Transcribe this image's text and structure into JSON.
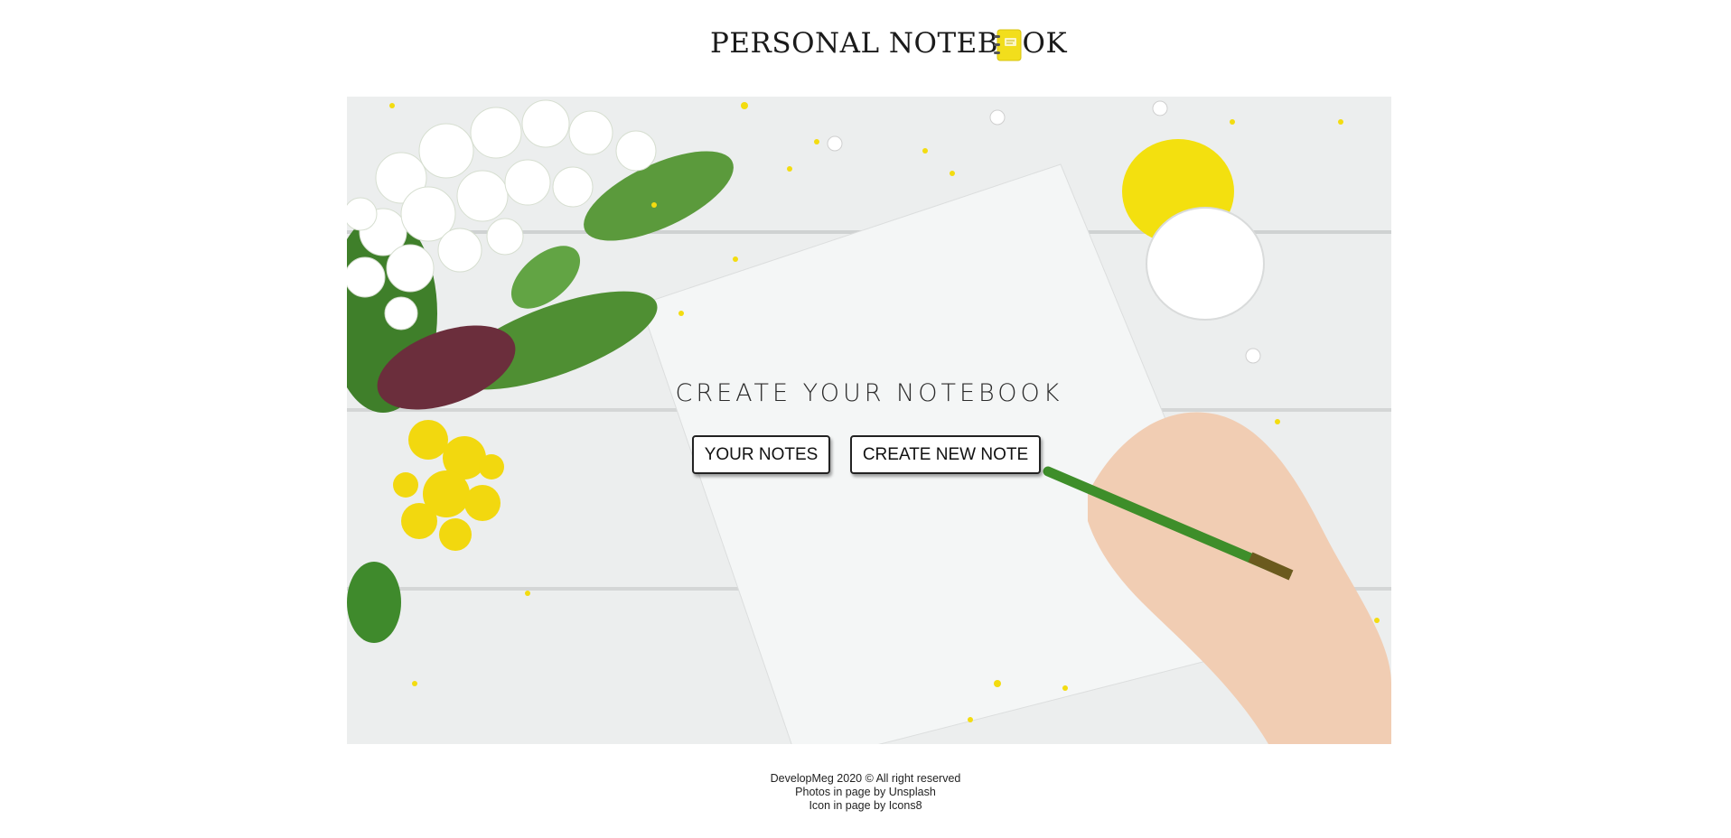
{
  "header": {
    "title": "PERSONAL NOTEBOOK",
    "logo_icon": "notebook-icon",
    "accent_color": "#f5e12a"
  },
  "hero": {
    "title": "CREATE YOUR NOTEBOOK",
    "buttons": {
      "your_notes": "YOUR NOTES",
      "create_new_note": "CREATE NEW NOTE"
    }
  },
  "footer": {
    "copyright": "DevelopMeg 2020 © All right reserved",
    "photos_credit": "Photos in page by Unsplash",
    "icon_credit": "Icon in page by Icons8"
  }
}
